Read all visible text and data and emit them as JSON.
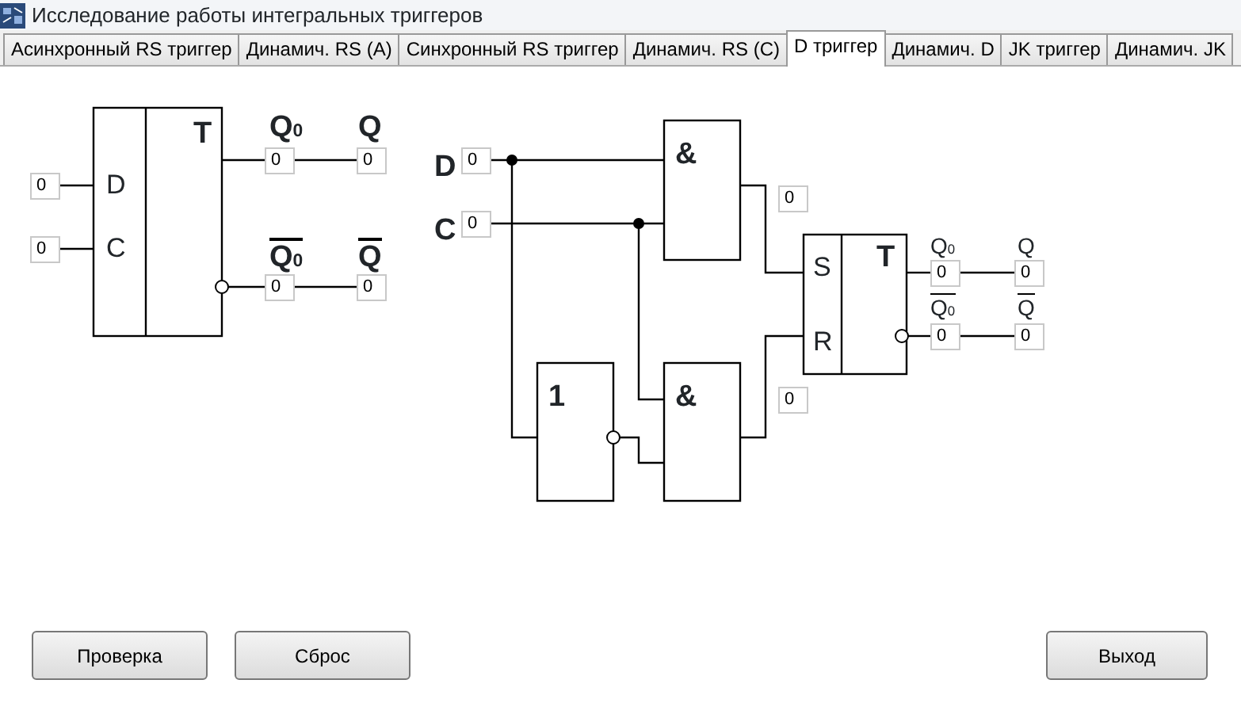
{
  "window": {
    "title": "Исследование работы интегральных триггеров"
  },
  "tabs": [
    {
      "label": "Асинхронный RS триггер",
      "selected": false
    },
    {
      "label": "Динамич.  RS (A)",
      "selected": false
    },
    {
      "label": "Синхронный RS триггер",
      "selected": false
    },
    {
      "label": "Динамич.  RS (C)",
      "selected": false
    },
    {
      "label": "D триггер",
      "selected": true
    },
    {
      "label": "Динамич. D",
      "selected": false
    },
    {
      "label": "JK триггер",
      "selected": false
    },
    {
      "label": "Динамич. JK",
      "selected": false
    }
  ],
  "d_trigger": {
    "block_label": "T",
    "inputs": [
      {
        "label": "D",
        "value": "0"
      },
      {
        "label": "C",
        "value": "0"
      }
    ],
    "outputs": [
      {
        "label": "Q$_{0}$",
        "inverted": false,
        "value": "0"
      },
      {
        "label": "Q",
        "inverted": false,
        "value": "0"
      },
      {
        "label": "Q$_{0}$",
        "inverted": true,
        "value": "0"
      },
      {
        "label": "Q",
        "inverted": true,
        "value": "0"
      }
    ]
  },
  "circuit": {
    "inputs": [
      {
        "label": "D",
        "value": "0"
      },
      {
        "label": "C",
        "value": "0"
      }
    ],
    "gates": [
      {
        "label": "&"
      },
      {
        "label": "1"
      },
      {
        "label": "&"
      }
    ],
    "gate_outputs": [
      {
        "value": "0"
      },
      {
        "value": "0"
      }
    ],
    "rs_trigger": {
      "set_label": "S",
      "reset_label": "R",
      "block_label": "T"
    },
    "outputs": [
      {
        "label": "Q$_{0}$",
        "inverted": false,
        "value": "0"
      },
      {
        "label": "Q",
        "inverted": false,
        "value": "0"
      },
      {
        "label": "Q$_{0}$",
        "inverted": true,
        "value": "0"
      },
      {
        "label": "Q",
        "inverted": true,
        "value": "0"
      }
    ]
  },
  "buttons": [
    {
      "label": "Проверка"
    },
    {
      "label": "Сброс"
    },
    {
      "label": "Выход"
    }
  ]
}
